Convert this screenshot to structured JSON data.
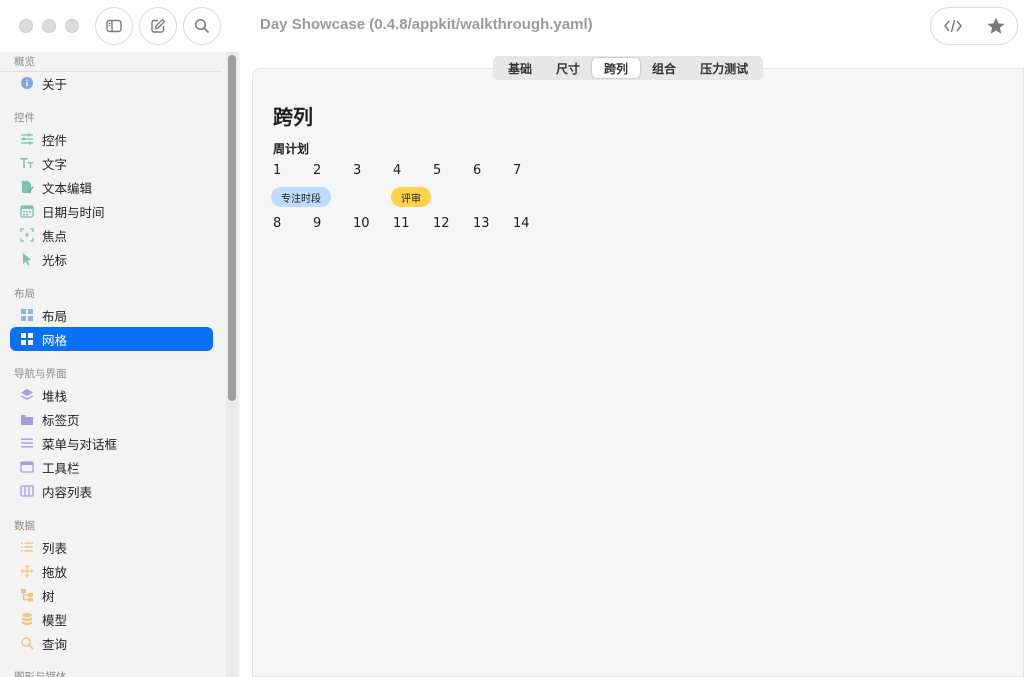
{
  "window": {
    "title": "Day Showcase (0.4.8/appkit/walkthrough.yaml)"
  },
  "sidebar": {
    "sections": {
      "overview": "概览",
      "controls": "控件",
      "layout": "布局",
      "navigation": "导航与界面",
      "data": "数据",
      "graphics": "图形与媒体"
    },
    "items": {
      "about": "关于",
      "controls": "控件",
      "text": "文字",
      "text_edit": "文本编辑",
      "date_time": "日期与时间",
      "focus": "焦点",
      "cursor": "光标",
      "layout": "布局",
      "grid": "网格",
      "stack": "堆栈",
      "tabs": "标签页",
      "menus_dialogs": "菜单与对话框",
      "toolbar": "工具栏",
      "content_list": "内容列表",
      "list": "列表",
      "drag_drop": "拖放",
      "tree": "树",
      "model": "模型",
      "query": "查询"
    }
  },
  "tabs": [
    "基础",
    "尺寸",
    "跨列",
    "组合",
    "压力测试"
  ],
  "selected_tab": "跨列",
  "content": {
    "title": "跨列",
    "subtitle": "周计划",
    "week1": [
      "1",
      "2",
      "3",
      "4",
      "5",
      "6",
      "7"
    ],
    "week2": [
      "8",
      "9",
      "10",
      "11",
      "12",
      "13",
      "14"
    ],
    "events": {
      "focus": "专注时段",
      "review": "评审"
    }
  },
  "colors": {
    "accent": "#0a70f5",
    "focus_event": "#bcdcfa",
    "review_event": "#fcd24a"
  }
}
